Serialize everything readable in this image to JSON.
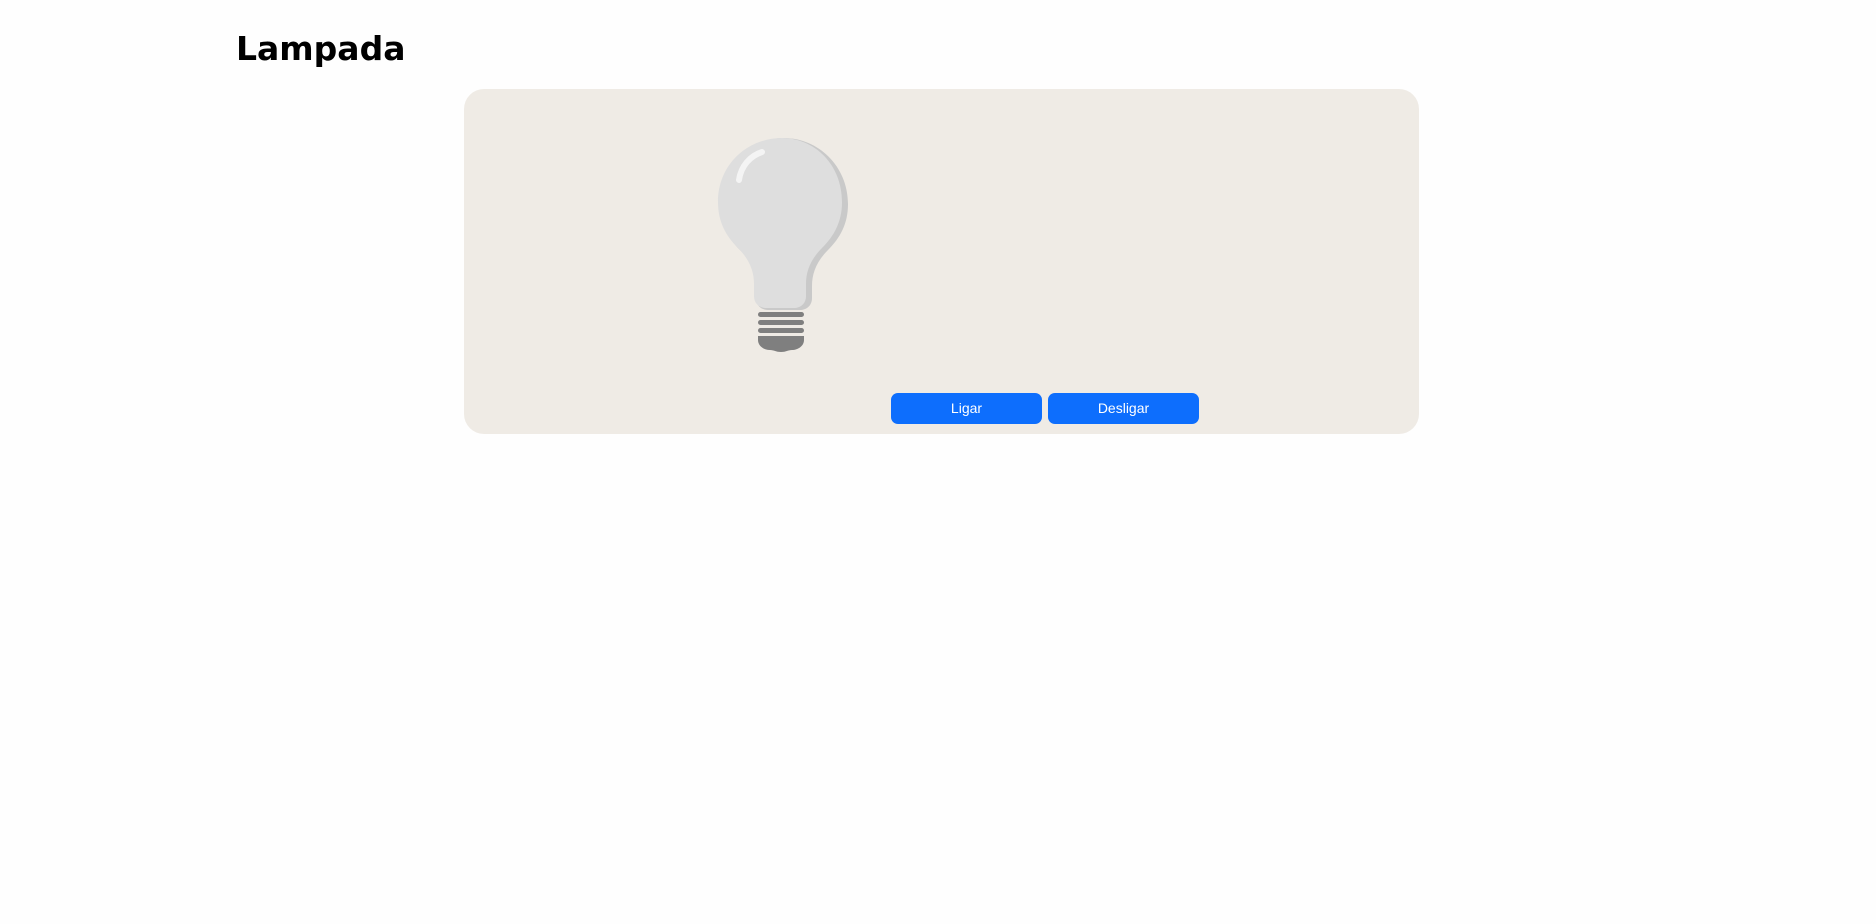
{
  "page": {
    "title": "Lampada"
  },
  "lamp": {
    "icon": "lightbulb-icon",
    "state": "off"
  },
  "controls": {
    "on_label": "Ligar",
    "off_label": "Desligar"
  },
  "colors": {
    "panel_background": "#efebe5",
    "button_background": "#0d6efd",
    "button_text": "#ffffff",
    "bulb_glass": "#dedede",
    "bulb_shadow": "#c9c9c9",
    "bulb_base": "#7f7f7f"
  }
}
